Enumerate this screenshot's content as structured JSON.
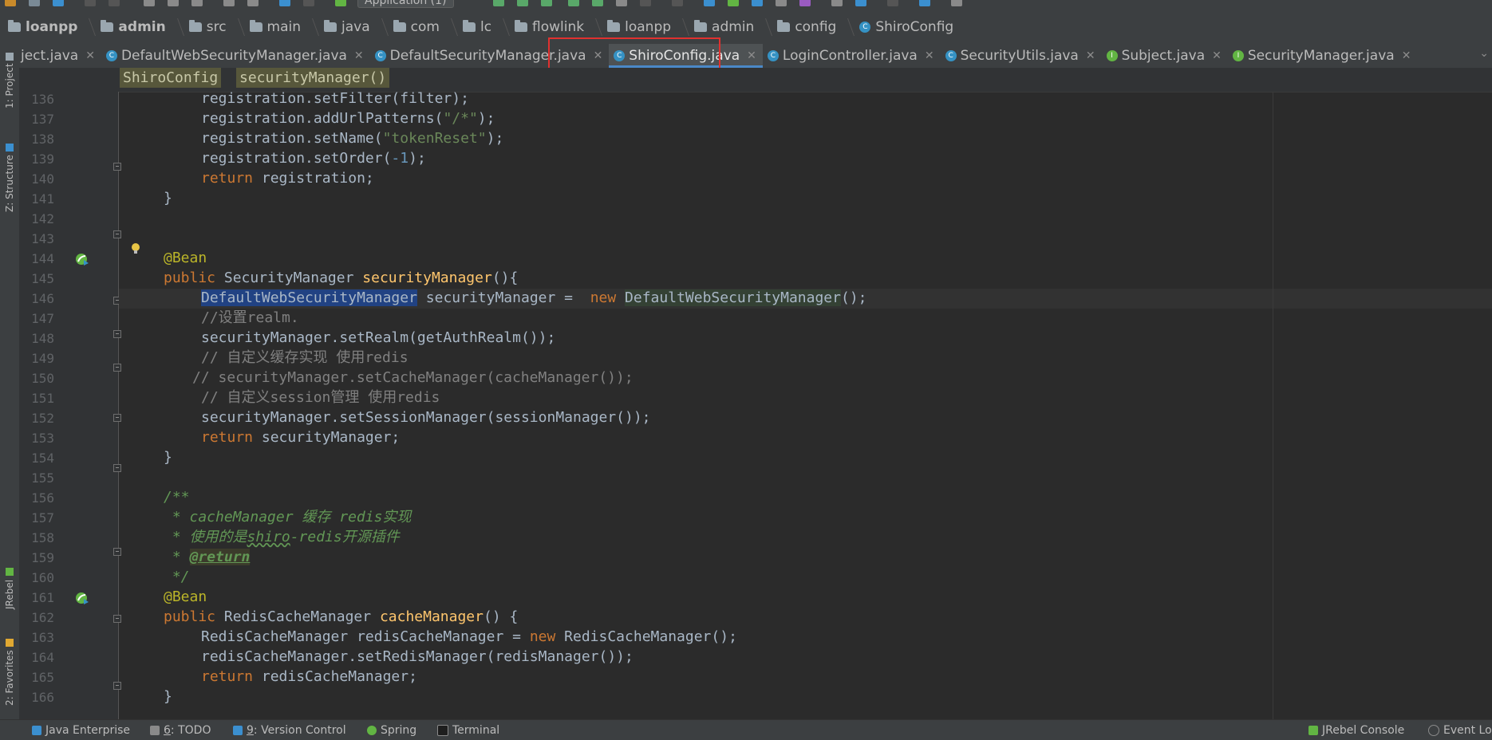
{
  "run_config": {
    "label": "Application (1)"
  },
  "breadcrumb": [
    "loanpp",
    "admin",
    "src",
    "main",
    "java",
    "com",
    "lc",
    "flowlink",
    "loanpp",
    "admin",
    "config",
    "ShiroConfig"
  ],
  "left_tools": {
    "project": "1: Project",
    "structure": "Z: Structure",
    "jrebel": "JRebel",
    "favorites": "2: Favorites"
  },
  "tabs": [
    {
      "label": "ject.java",
      "kind": "none"
    },
    {
      "label": "DefaultWebSecurityManager.java",
      "kind": "class"
    },
    {
      "label": "DefaultSecurityManager.java",
      "kind": "class"
    },
    {
      "label": "ShiroConfig.java",
      "kind": "class",
      "active": true
    },
    {
      "label": "LoginController.java",
      "kind": "class"
    },
    {
      "label": "SecurityUtils.java",
      "kind": "class"
    },
    {
      "label": "Subject.java",
      "kind": "interface"
    },
    {
      "label": "SecurityManager.java",
      "kind": "interface"
    }
  ],
  "editor_breadcrumb": {
    "class_name": "ShiroConfig",
    "method_name": "securityManager()"
  },
  "line_numbers": [
    "136",
    "137",
    "138",
    "139",
    "140",
    "141",
    "142",
    "143",
    "144",
    "145",
    "146",
    "147",
    "148",
    "149",
    "150",
    "151",
    "152",
    "153",
    "154",
    "155",
    "156",
    "157",
    "158",
    "159",
    "160",
    "161",
    "162",
    "163",
    "164",
    "165",
    "166"
  ],
  "code": {
    "l136": "registration.setFilter(filter);",
    "l137a": "registration.addUrlPatterns(",
    "l137s": "\"/*\"",
    "l137b": ");",
    "l138a": "registration.setName(",
    "l138s": "\"tokenReset\"",
    "l138b": ");",
    "l139a": "registration.setOrder(",
    "l139n": "-1",
    "l139b": ");",
    "l140k": "return",
    "l140b": " registration;",
    "l141": "}",
    "l144": "@Bean",
    "l145k": "public",
    "l145a": " SecurityManager ",
    "l145f": "securityManager",
    "l145b": "(){",
    "l146sel": "DefaultWebSecurityManager",
    "l146a": " securityManager =  ",
    "l146k": "new",
    "l146c": "DefaultWebSecurityManager",
    "l146b": "();",
    "l147": "//设置realm.",
    "l148": "securityManager.setRealm(getAuthRealm());",
    "l149": "// 自定义缓存实现 使用redis",
    "l150": "// securityManager.setCacheManager(cacheManager());",
    "l151": "// 自定义session管理 使用redis",
    "l152": "securityManager.setSessionManager(sessionManager());",
    "l153k": "return",
    "l153b": " securityManager;",
    "l154": "}",
    "l156": "/**",
    "l157": " * cacheManager 缓存 redis实现",
    "l158a": " * 使用的是",
    "l158t": "shiro",
    "l158b": "-redis开源插件",
    "l159a": " * ",
    "l159t": "@return",
    "l160": " */",
    "l161": "@Bean",
    "l162k": "public",
    "l162a": " RedisCacheManager ",
    "l162f": "cacheManager",
    "l162b": "() {",
    "l163a": "RedisCacheManager redisCacheManager = ",
    "l163k": "new",
    "l163b": " RedisCacheManager();",
    "l164": "redisCacheManager.setRedisManager(redisManager());",
    "l165k": "return",
    "l165b": " redisCacheManager;",
    "l166": "}"
  },
  "statusbar": {
    "java_enterprise": "Java Enterprise",
    "todo_num": "6",
    "todo": ": TODO",
    "vc_num": "9",
    "vc": ": Version Control",
    "spring": "Spring",
    "terminal": "Terminal",
    "jrebel_console": "JRebel Console",
    "event_log": "Event Lo"
  },
  "colors": {
    "background": "#2b2b2b",
    "keyword": "#cc7832",
    "string": "#6a8759",
    "number": "#6897bb",
    "annotation": "#bbb529",
    "method": "#ffc66d",
    "comment": "#808080",
    "selection": "#214283",
    "highlight_box": "#e0312f"
  }
}
